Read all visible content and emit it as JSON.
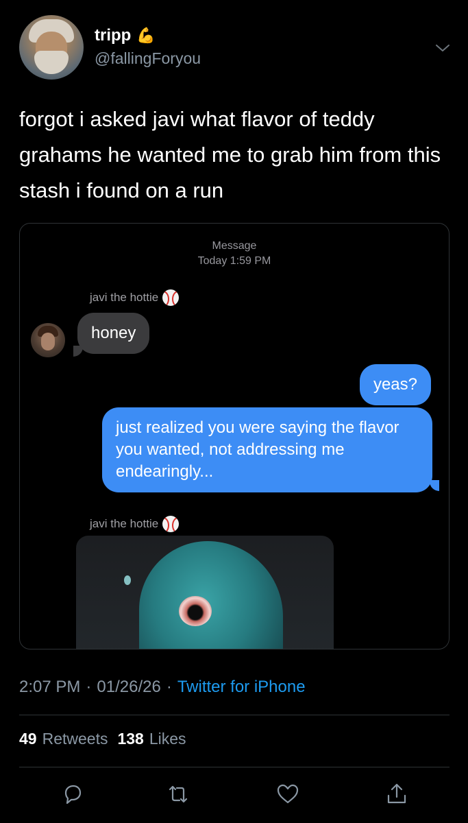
{
  "user": {
    "name": "tripp",
    "name_emoji": "💪",
    "handle": "@fallingForyou"
  },
  "tweet": {
    "text": "forgot i asked javi what flavor of teddy grahams he wanted me to grab him from this stash i found on a run"
  },
  "message_screenshot": {
    "header_title": "Message",
    "header_time": "Today 1:59 PM",
    "contact_name": "javi the hottie",
    "contact_emoji": "baseball-icon",
    "messages": [
      {
        "direction": "incoming",
        "text": "honey"
      },
      {
        "direction": "outgoing",
        "text": "yeas?"
      },
      {
        "direction": "outgoing",
        "text": "just realized you were saying the flavor you wanted, not addressing me endearingly..."
      }
    ],
    "image_reply_sender": "javi the hottie"
  },
  "meta": {
    "time": "2:07 PM",
    "separator": "·",
    "date": "01/26/26",
    "source": "Twitter for iPhone"
  },
  "stats": {
    "retweets_count": "49",
    "retweets_label": "Retweets",
    "likes_count": "138",
    "likes_label": "Likes"
  },
  "colors": {
    "background": "#000000",
    "link": "#1d9bf0",
    "outgoing_bubble": "#3d8df5",
    "incoming_bubble": "#3b3b3d",
    "secondary_text": "#8b98a5"
  },
  "actions": [
    "reply-icon",
    "retweet-icon",
    "like-icon",
    "share-icon"
  ]
}
